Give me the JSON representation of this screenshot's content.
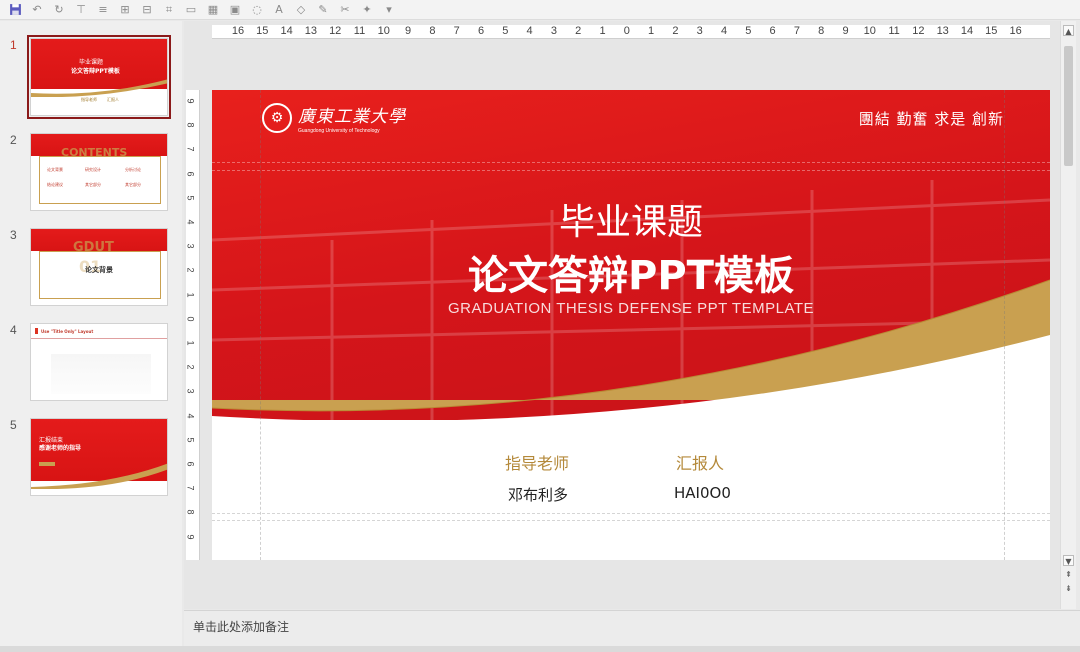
{
  "toolbar": {
    "icons": [
      "save-icon",
      "undo-icon",
      "redo-icon",
      "format-icon",
      "align-icon",
      "distribute-icon",
      "arrange-icon",
      "crop-icon",
      "shapes-icon",
      "table-icon",
      "image-icon",
      "chart-icon",
      "text-color-icon",
      "fill-color-icon",
      "line-color-icon",
      "format-painter-icon",
      "effects-icon",
      "more-icon"
    ]
  },
  "slides": [
    {
      "number": "1",
      "title": "毕业课题",
      "subtitle": "论文答辩PPT模板"
    },
    {
      "number": "2",
      "title": "CONTENTS",
      "items": [
        "论文背景",
        "研究设计",
        "分析讨论",
        "结论建议",
        "其它部分",
        "其它部分"
      ]
    },
    {
      "number": "3",
      "title": "GDUT",
      "big": "01",
      "heading": "论文背景"
    },
    {
      "number": "4",
      "title": "Use \"Title Only\" Layout"
    },
    {
      "number": "5",
      "title": "汇报结束",
      "subtitle": "感谢老师的指导"
    }
  ],
  "ruler": {
    "h_marks": [
      "16",
      "15",
      "14",
      "13",
      "12",
      "11",
      "10",
      "9",
      "8",
      "7",
      "6",
      "5",
      "4",
      "3",
      "2",
      "1",
      "0",
      "1",
      "2",
      "3",
      "4",
      "5",
      "6",
      "7",
      "8",
      "9",
      "10",
      "11",
      "12",
      "13",
      "14",
      "15",
      "16"
    ],
    "v_marks": [
      "9",
      "8",
      "7",
      "6",
      "5",
      "4",
      "3",
      "2",
      "1",
      "0",
      "1",
      "2",
      "3",
      "4",
      "5",
      "6",
      "7",
      "8",
      "9"
    ]
  },
  "slide": {
    "university_cn": "廣東工業大學",
    "university_en": "Guangdong University of Technology",
    "motto": "團結 勤奮 求是 創新",
    "title_line1": "毕业课题",
    "title_line2": "论文答辩PPT模板",
    "subtitle_en": "GRADUATION THESIS DEFENSE PPT TEMPLATE",
    "advisor_label": "指导老师",
    "advisor_name": "邓布利多",
    "reporter_label": "汇报人",
    "reporter_name": "HAI0O0"
  },
  "notes": {
    "placeholder": "单击此处添加备注"
  },
  "colors": {
    "accent_red": "#e01d1c",
    "gold": "#c9a050"
  }
}
